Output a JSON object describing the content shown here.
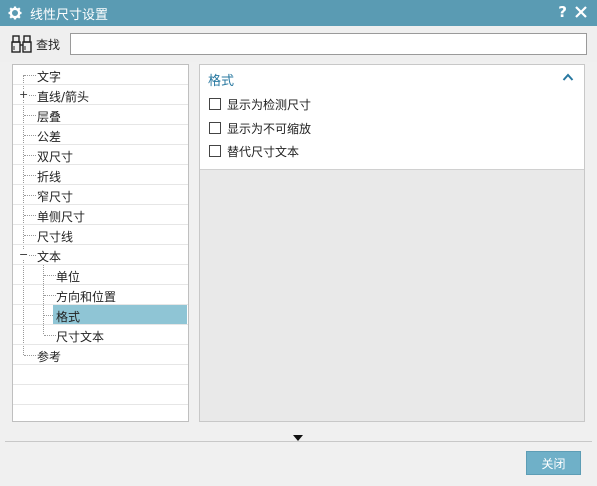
{
  "window": {
    "title": "线性尺寸设置",
    "help_label": "?"
  },
  "find": {
    "label": "查找",
    "value": ""
  },
  "tree": {
    "items": [
      {
        "label": "文字"
      },
      {
        "label": "直线/箭头",
        "expander": "+"
      },
      {
        "label": "层叠"
      },
      {
        "label": "公差"
      },
      {
        "label": "双尺寸"
      },
      {
        "label": "折线"
      },
      {
        "label": "窄尺寸"
      },
      {
        "label": "单侧尺寸"
      },
      {
        "label": "尺寸线"
      },
      {
        "label": "文本",
        "expander": "−"
      },
      {
        "label": "单位"
      },
      {
        "label": "方向和位置"
      },
      {
        "label": "格式",
        "selected": true
      },
      {
        "label": "尺寸文本"
      },
      {
        "label": "参考"
      }
    ]
  },
  "format_group": {
    "title": "格式",
    "options": [
      {
        "label": "显示为检测尺寸",
        "checked": false
      },
      {
        "label": "显示为不可缩放",
        "checked": false
      },
      {
        "label": "替代尺寸文本",
        "checked": false
      }
    ]
  },
  "footer": {
    "close_label": "关闭"
  },
  "colors": {
    "titlebar": "#5a9bb3",
    "selection": "#8fc5d5",
    "group_title": "#2878a0",
    "button": "#6fb0c8"
  },
  "icons": {
    "window_icon": "gear-icon",
    "find_icon": "binoculars-icon",
    "close_icon": "close-icon",
    "collapse_icon": "chevron-up-icon",
    "more_icon": "triangle-down-icon"
  }
}
